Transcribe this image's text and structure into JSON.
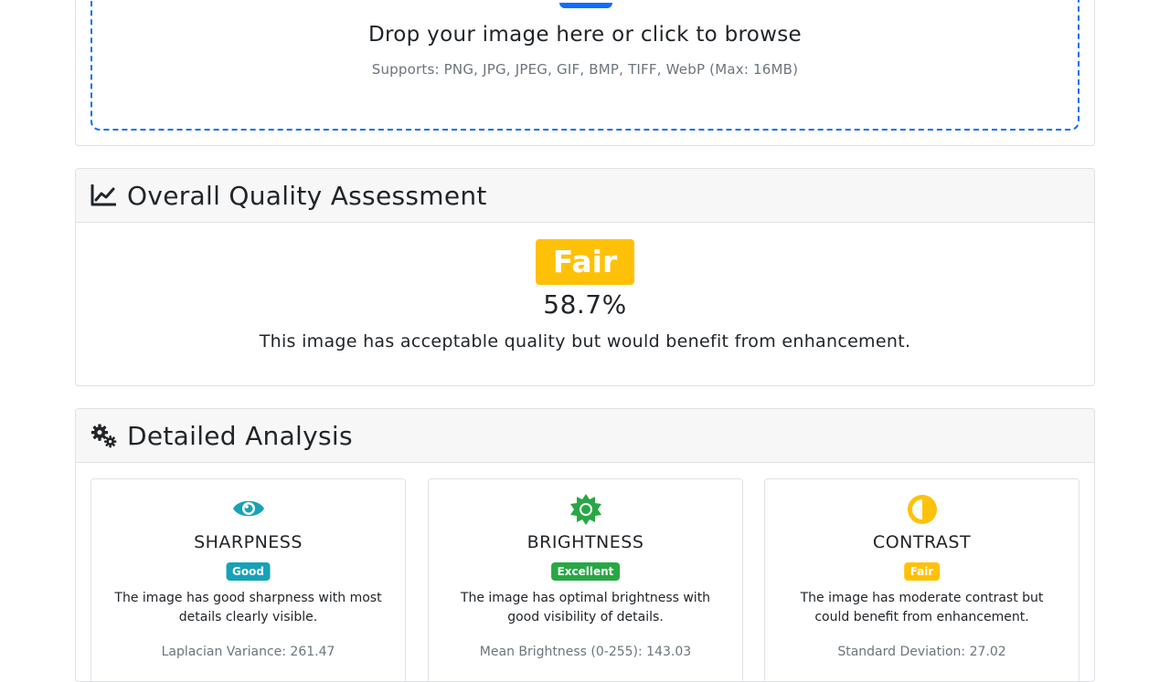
{
  "upload": {
    "title": "Drop your image here or click to browse",
    "supports": "Supports: PNG, JPG, JPEG, GIF, BMP, TIFF, WebP (Max: 16MB)"
  },
  "overall": {
    "header": "Overall Quality Assessment",
    "header_icon": "chart-line-icon",
    "grade": "Fair",
    "grade_color": "#ffc107",
    "score": "58.7%",
    "description": "This image has acceptable quality but would benefit from enhancement."
  },
  "detailed": {
    "header": "Detailed Analysis",
    "header_icon": "cogs-icon",
    "metrics": [
      {
        "name": "SHARPNESS",
        "icon": "eye-icon",
        "icon_color": "#17a2b8",
        "rating": "Good",
        "rating_color": "#17a2b8",
        "description": "The image has good sharpness with most details clearly visible.",
        "value": "Laplacian Variance: 261.47"
      },
      {
        "name": "BRIGHTNESS",
        "icon": "sun-icon",
        "icon_color": "#28a745",
        "rating": "Excellent",
        "rating_color": "#28a745",
        "description": "The image has optimal brightness with good visibility of details.",
        "value": "Mean Brightness (0-255): 143.03"
      },
      {
        "name": "CONTRAST",
        "icon": "adjust-icon",
        "icon_color": "#ffc107",
        "rating": "Fair",
        "rating_color": "#ffc107",
        "description": "The image has moderate contrast but could benefit from enhancement.",
        "value": "Standard Deviation: 27.02"
      }
    ]
  }
}
